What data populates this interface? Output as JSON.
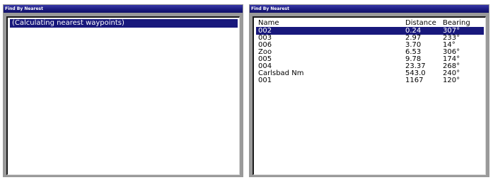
{
  "left_panel": {
    "title": "Find By Nearest",
    "status": "(Calculating nearest waypoints)"
  },
  "right_panel": {
    "title": "Find By Nearest",
    "columns": {
      "name": "Name",
      "distance": "Distance",
      "bearing": "Bearing"
    },
    "selected_index": 0,
    "rows": [
      {
        "name": "002",
        "distance": "0.24",
        "bearing": "307°"
      },
      {
        "name": "003",
        "distance": "2.97",
        "bearing": "233°"
      },
      {
        "name": "006",
        "distance": "3.70",
        "bearing": "14°"
      },
      {
        "name": "Zoo",
        "distance": "6.53",
        "bearing": "306°"
      },
      {
        "name": "005",
        "distance": "9.78",
        "bearing": "174°"
      },
      {
        "name": "004",
        "distance": "23.37",
        "bearing": "268°"
      },
      {
        "name": "Carlsbad Nm",
        "distance": "543.0",
        "bearing": "240°"
      },
      {
        "name": "001",
        "distance": "1167",
        "bearing": "120°"
      }
    ]
  },
  "colors": {
    "titlebar": "#1c1c80",
    "selection": "#18187c",
    "frame": "#9a9a9a"
  }
}
